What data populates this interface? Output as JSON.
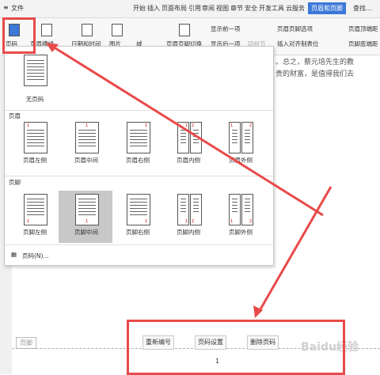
{
  "menubar": {
    "file": "文件",
    "tabs": [
      "开始",
      "插入",
      "页面布局",
      "引用",
      "审阅",
      "视图",
      "章节",
      "安全",
      "开发工具",
      "云服务",
      "页眉和页脚"
    ],
    "search": "查找..."
  },
  "ribbon": {
    "page_number": "页码",
    "header_footer": "页眉横线",
    "date_time": "日期和时间",
    "picture": "图片",
    "field": "域",
    "switch": "页眉页脚切换",
    "show_prev": "显示前一项",
    "show_next": "显示后一项",
    "same_as_prev": "同前节",
    "hf_options": "页眉页脚选项",
    "insert_tab": "插入对齐制表位",
    "header_top": "页眉顶端距",
    "footer_bottom": "页脚底端距"
  },
  "document": {
    "line1": "。总之，蔡元培先生的教",
    "line2": "贵的财富，是值得我们去"
  },
  "dropdown": {
    "none": "无页码",
    "header_section": "页眉",
    "footer_section": "页脚",
    "header_items": [
      "页眉左侧",
      "页眉中间",
      "页眉右侧",
      "页眉内侧",
      "页眉外侧"
    ],
    "footer_items": [
      "页脚左侧",
      "页脚中间",
      "页脚右侧",
      "页脚内侧",
      "页脚外侧"
    ],
    "more": "页码(N)..."
  },
  "footer": {
    "label": "页脚",
    "renumber": "重新编号",
    "page_settings": "页码设置",
    "delete": "删除页码",
    "page_num": "1"
  },
  "watermark": "Baidu经验",
  "colors": {
    "accent": "#3b78d8",
    "highlight": "#e84a4a"
  }
}
